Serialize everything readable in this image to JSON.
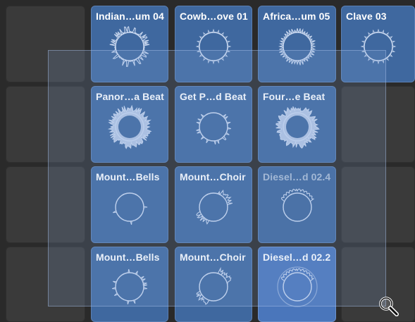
{
  "cells": [
    {
      "row": 0,
      "col": 1,
      "title": "Indian…um 04",
      "wave": "spiky"
    },
    {
      "row": 0,
      "col": 2,
      "title": "Cowb…ove 01",
      "wave": "ticks"
    },
    {
      "row": 0,
      "col": 3,
      "title": "Africa…um 05",
      "wave": "ticks-dense"
    },
    {
      "row": 0,
      "col": 4,
      "title": "Clave 03",
      "wave": "ticks"
    },
    {
      "row": 1,
      "col": 1,
      "title": "Panor…a Beat",
      "wave": "burst"
    },
    {
      "row": 1,
      "col": 2,
      "title": "Get P…d Beat",
      "wave": "sparse"
    },
    {
      "row": 1,
      "col": 3,
      "title": "Four…e Beat",
      "wave": "burst"
    },
    {
      "row": 2,
      "col": 1,
      "title": "Mount…Bells",
      "wave": "sparse"
    },
    {
      "row": 2,
      "col": 2,
      "title": "Mount…Choir",
      "wave": "choir"
    },
    {
      "row": 2,
      "col": 3,
      "title": "Diesel…d 02.4",
      "wave": "bumps",
      "state": "dim"
    },
    {
      "row": 3,
      "col": 1,
      "title": "Mount…Bells",
      "wave": "sparse"
    },
    {
      "row": 3,
      "col": 2,
      "title": "Mount…Choir",
      "wave": "choir"
    },
    {
      "row": 3,
      "col": 3,
      "title": "Diesel…d 02.2",
      "wave": "bumps",
      "state": "sel"
    }
  ],
  "colors": {
    "cell": "#3f689f",
    "selected": "#4a76bb",
    "wave": "#c7d6ee",
    "empty": "#3a3a3a"
  },
  "cursor_icon": "zoom-magnifier-icon"
}
